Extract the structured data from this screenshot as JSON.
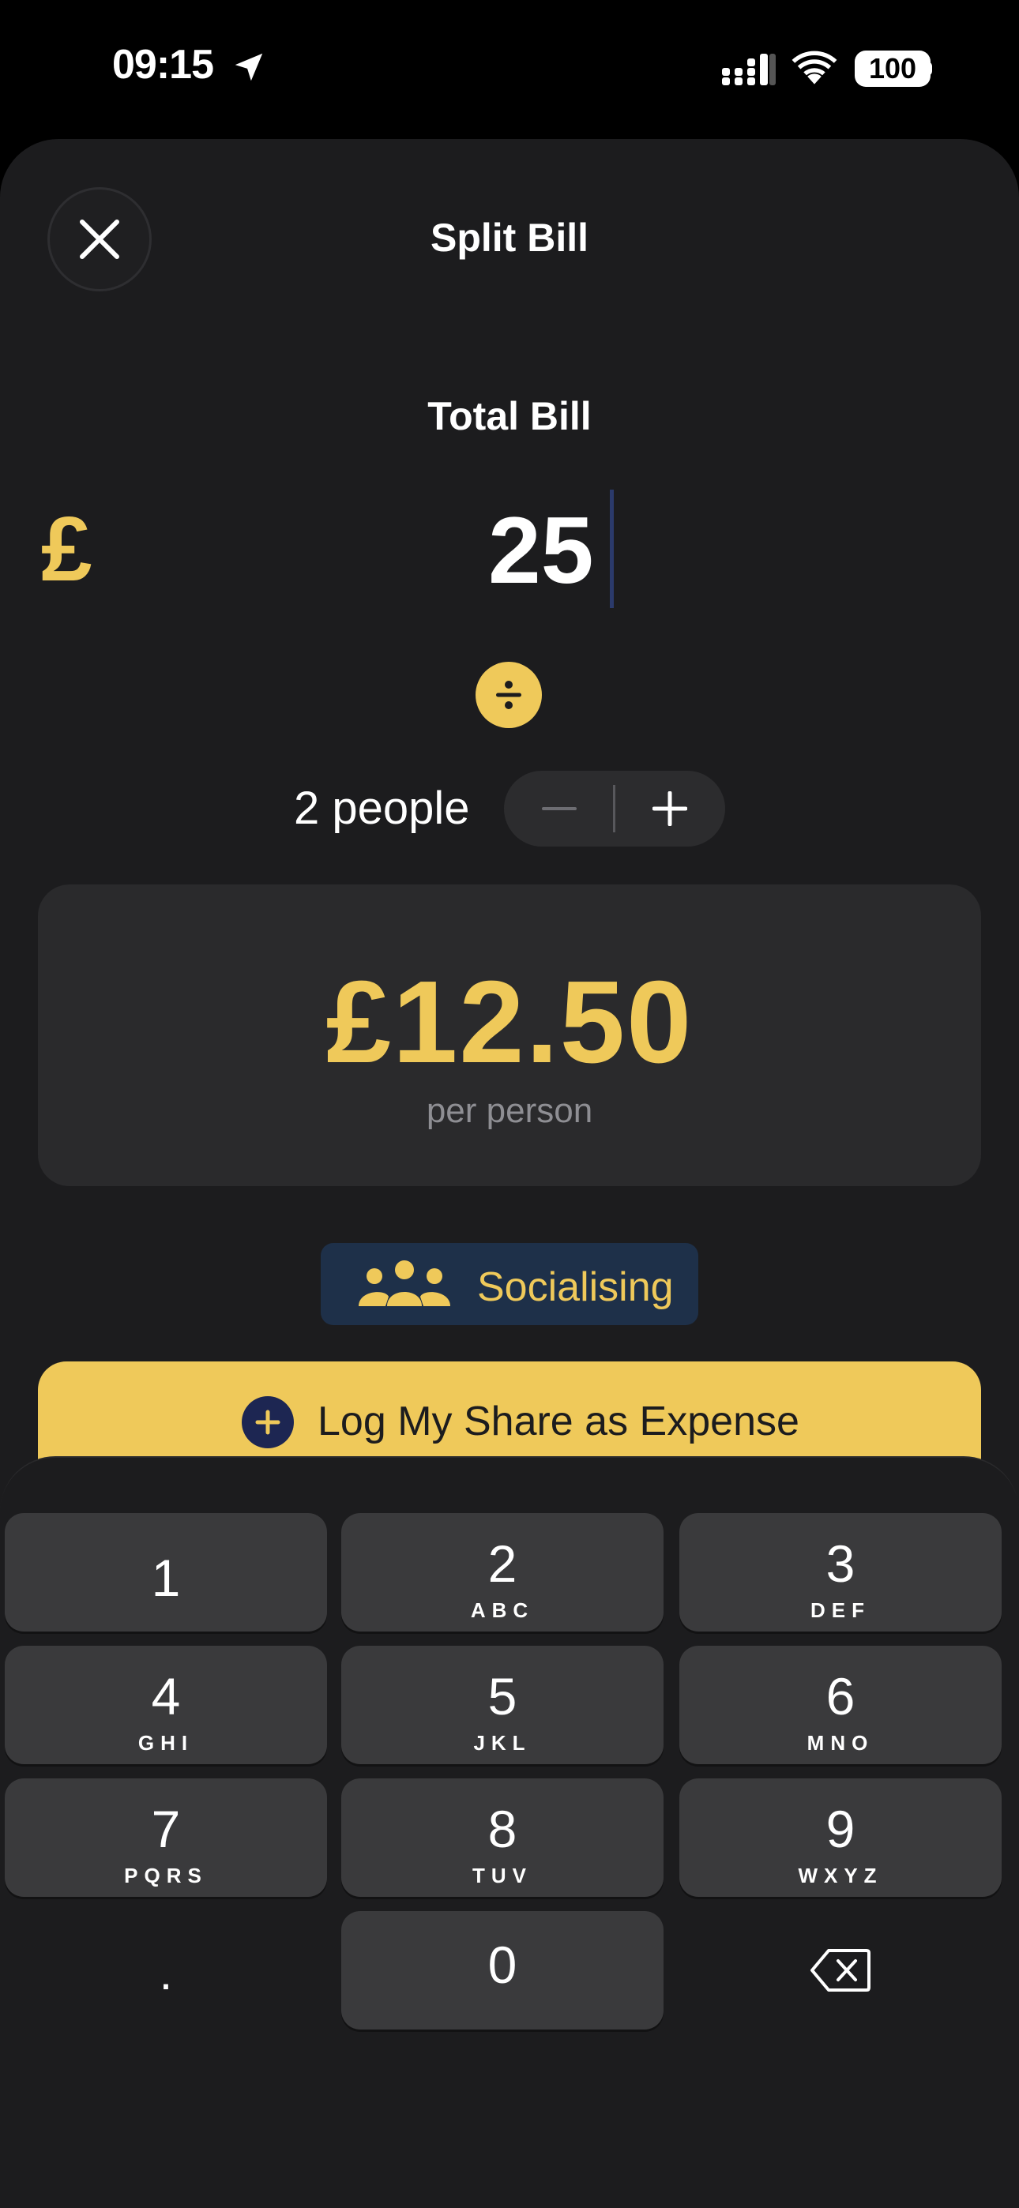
{
  "status_bar": {
    "time": "09:15",
    "battery": "100",
    "icons": [
      "location-arrow-icon",
      "signal-icon",
      "wifi-icon",
      "battery-icon"
    ]
  },
  "header": {
    "title": "Split Bill",
    "close_icon": "close-icon"
  },
  "bill": {
    "label": "Total Bill",
    "currency": "£",
    "amount": "25"
  },
  "people": {
    "label": "2 people",
    "minus_icon": "minus-icon",
    "plus_icon": "plus-icon"
  },
  "result": {
    "amount": "£12.50",
    "label": "per person"
  },
  "category": {
    "icon": "people-group-icon",
    "label": "Socialising"
  },
  "log_button": {
    "icon": "plus-circle-icon",
    "label": "Log My Share as Expense"
  },
  "keypad": {
    "keys": [
      {
        "digit": "1",
        "letters": ""
      },
      {
        "digit": "2",
        "letters": "ABC"
      },
      {
        "digit": "3",
        "letters": "DEF"
      },
      {
        "digit": "4",
        "letters": "GHI"
      },
      {
        "digit": "5",
        "letters": "JKL"
      },
      {
        "digit": "6",
        "letters": "MNO"
      },
      {
        "digit": "7",
        "letters": "PQRS"
      },
      {
        "digit": "8",
        "letters": "TUV"
      },
      {
        "digit": "9",
        "letters": "WXYZ"
      },
      {
        "digit": "0",
        "letters": ""
      }
    ],
    "dot": ".",
    "delete_icon": "backspace-icon"
  },
  "colors": {
    "accent": "#efc95a",
    "background": "#1c1c1e",
    "card": "#2a2a2c",
    "chip": "#1e3049",
    "key": "#3a3a3c"
  }
}
